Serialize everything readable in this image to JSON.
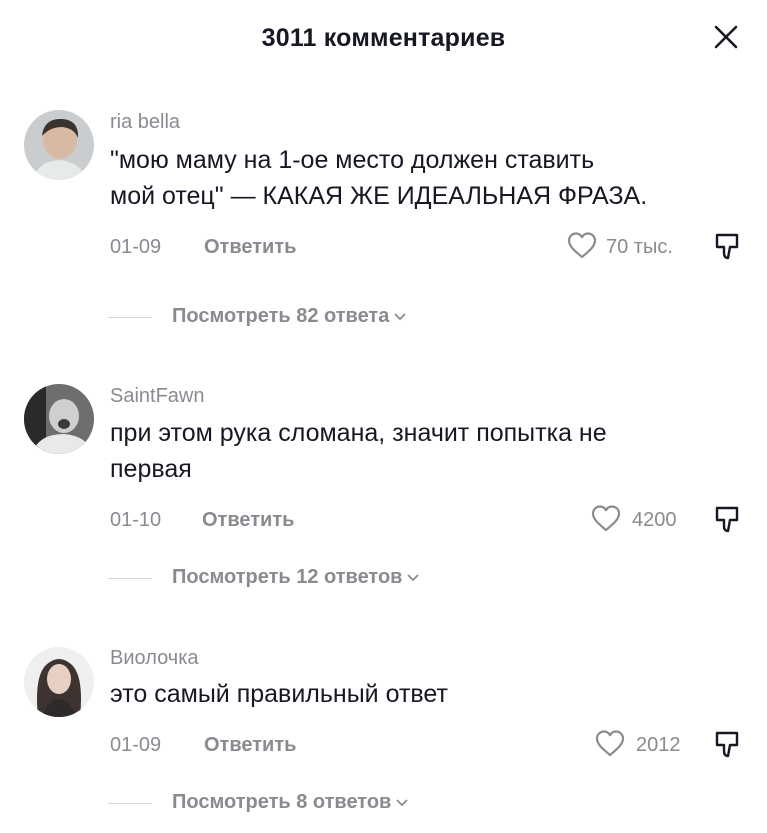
{
  "header": {
    "title": "3011 комментариев",
    "close_icon": "close-icon"
  },
  "comments": [
    {
      "author": "ria bella",
      "lines": [
        "\"мою маму на 1-ое место должен ставить",
        "мой отец\" — КАКАЯ ЖЕ ИДЕАЛЬНАЯ ФРАЗА."
      ],
      "date": "01-09",
      "reply_label": "Ответить",
      "likes": "70 тыс.",
      "view_replies": "Посмотреть 82 ответа"
    },
    {
      "author": "SaintFawn",
      "lines": [
        "при этом рука сломана, значит попытка не",
        "первая"
      ],
      "date": "01-10",
      "reply_label": "Ответить",
      "likes": "4200",
      "view_replies": "Посмотреть 12 ответов"
    },
    {
      "author": "Виолочка",
      "lines": [
        "это самый правильный ответ"
      ],
      "date": "01-09",
      "reply_label": "Ответить",
      "likes": "2012",
      "view_replies": "Посмотреть 8 ответов"
    }
  ],
  "icons": {
    "like": "heart-outline-icon",
    "dislike": "thumbs-down-icon",
    "expand": "chevron-down-icon"
  },
  "colors": {
    "text": "#161823",
    "secondary": "#8a8b91",
    "divider": "#d6d6d9",
    "background": "#ffffff"
  }
}
